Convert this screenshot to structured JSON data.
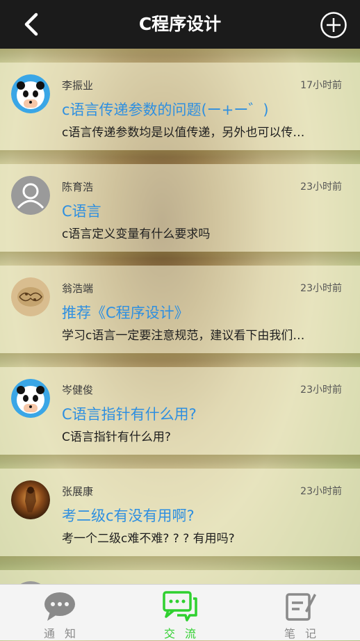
{
  "header": {
    "title": "C程序设计"
  },
  "posts": [
    {
      "author": "李振业",
      "time": "17小时前",
      "title": "c语言传递参数的问题(ー+ー゛)",
      "excerpt": "c语言传递参数均是以值传递，另外也可以传…",
      "avatar": "panda"
    },
    {
      "author": "陈育浩",
      "time": "23小时前",
      "title": "C语言",
      "excerpt": "c语言定义变量有什么要求吗",
      "avatar": "default"
    },
    {
      "author": "翁浩端",
      "time": "23小时前",
      "title": "推荐《C程序设计》",
      "excerpt": "学习c语言一定要注意规范，建议看下由我们…",
      "avatar": "brain"
    },
    {
      "author": "岑健俊",
      "time": "23小时前",
      "title": "C语言指针有什么用?",
      "excerpt": "C语言指针有什么用?",
      "avatar": "panda"
    },
    {
      "author": "张展康",
      "time": "23小时前",
      "title": "考二级c有没有用啊?",
      "excerpt": "考一个二级c难不难? ? ? 有用吗?",
      "avatar": "photo"
    }
  ],
  "tabs": [
    {
      "label": "通知",
      "icon": "chat-bubble-icon",
      "active": false
    },
    {
      "label": "交流",
      "icon": "discussion-icon",
      "active": true
    },
    {
      "label": "笔记",
      "icon": "note-icon",
      "active": false
    }
  ],
  "colors": {
    "active": "#2fd02f",
    "inactive": "#8a8a8a",
    "link": "#2e8fe0"
  }
}
